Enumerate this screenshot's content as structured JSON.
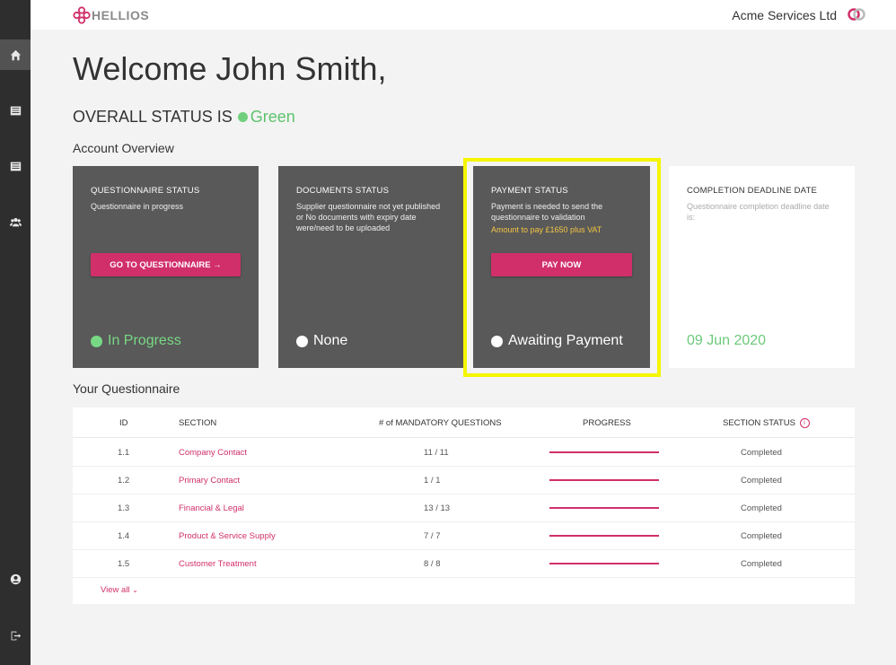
{
  "brand": {
    "name": "HELLIOS"
  },
  "topbar": {
    "company": "Acme Services Ltd",
    "profile_icon": "company-switch-icon"
  },
  "sidebar": {
    "items": [
      {
        "icon": "home-icon"
      },
      {
        "icon": "list-icon"
      },
      {
        "icon": "list-icon"
      },
      {
        "icon": "users-icon"
      },
      {
        "icon": "user-circle-icon"
      },
      {
        "icon": "logout-icon"
      }
    ]
  },
  "welcome": "Welcome John Smith,",
  "overall": {
    "label": "OVERALL STATUS IS",
    "value": "Green",
    "color": "#5ec26c"
  },
  "account_overview_title": "Account Overview",
  "cards": {
    "questionnaire": {
      "title": "QUESTIONNAIRE STATUS",
      "desc": "Questionnaire in progress",
      "button": "GO TO QUESTIONNAIRE →",
      "status": "In Progress"
    },
    "documents": {
      "title": "DOCUMENTS STATUS",
      "desc": "Supplier questionnaire not yet published or No documents with expiry date were/need to be uploaded",
      "status": "None"
    },
    "payment": {
      "title": "PAYMENT STATUS",
      "desc": "Payment is needed to send the questionnaire to validation",
      "amount": "Amount to pay £1650 plus VAT",
      "button": "PAY NOW",
      "status": "Awaiting Payment"
    },
    "deadline": {
      "title": "COMPLETION DEADLINE DATE",
      "desc": "Questionnaire completion deadline date is:",
      "date": "09 Jun 2020"
    }
  },
  "questionnaire": {
    "title": "Your Questionnaire",
    "headers": {
      "id": "ID",
      "section": "SECTION",
      "mandatory": "# of MANDATORY QUESTIONS",
      "progress": "PROGRESS",
      "status": "SECTION STATUS"
    },
    "rows": [
      {
        "id": "1.1",
        "section": "Company Contact",
        "mandatory": "11 / 11",
        "progress": 1.0,
        "status": "Completed"
      },
      {
        "id": "1.2",
        "section": "Primary Contact",
        "mandatory": "1 / 1",
        "progress": 1.0,
        "status": "Completed"
      },
      {
        "id": "1.3",
        "section": "Financial & Legal",
        "mandatory": "13 / 13",
        "progress": 1.0,
        "status": "Completed"
      },
      {
        "id": "1.4",
        "section": "Product & Service Supply",
        "mandatory": "7 / 7",
        "progress": 1.0,
        "status": "Completed"
      },
      {
        "id": "1.5",
        "section": "Customer Treatment",
        "mandatory": "8 / 8",
        "progress": 1.0,
        "status": "Completed"
      }
    ],
    "view_all": "View all"
  },
  "colors": {
    "accent": "#d12f6a",
    "sidebar": "#2e2e2e",
    "card": "#595959",
    "highlight": "#f5f500"
  }
}
